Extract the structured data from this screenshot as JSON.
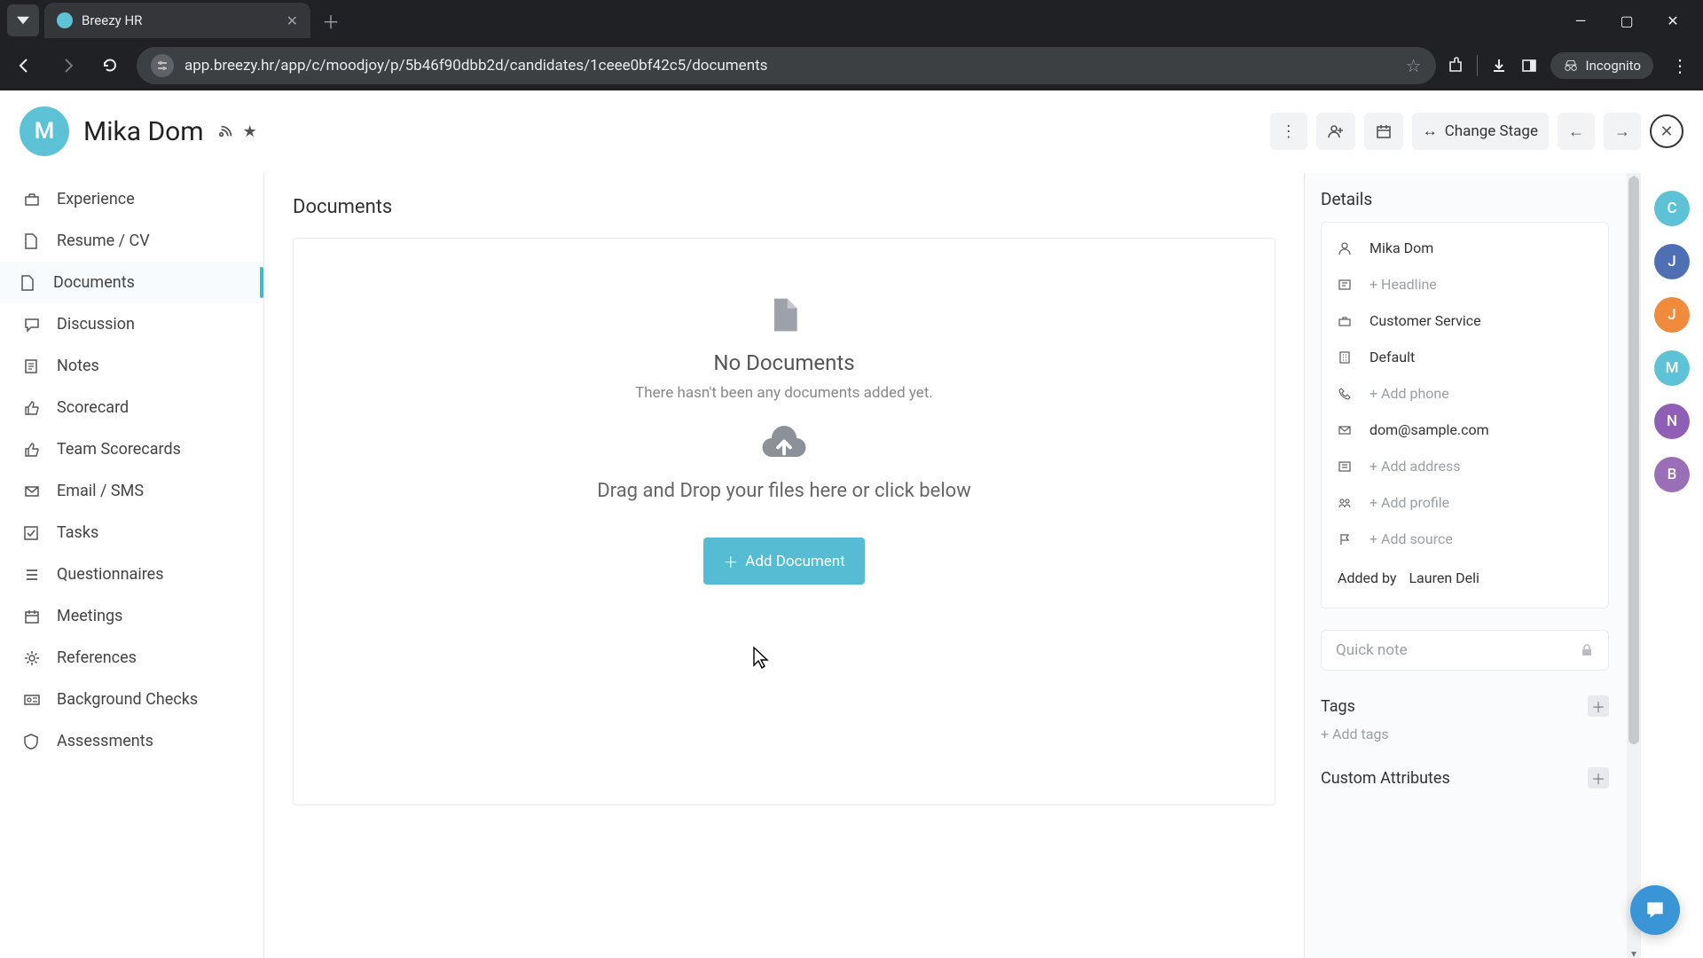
{
  "browser": {
    "tab_title": "Breezy HR",
    "url": "app.breezy.hr/app/c/moodjoy/p/5b46f90dbb2d/candidates/1ceee0bf42c5/documents",
    "incognito_label": "Incognito"
  },
  "header": {
    "avatar_initial": "M",
    "candidate_name": "Mika Dom",
    "change_stage_label": "Change Stage"
  },
  "sidebar": {
    "items": [
      {
        "label": "Experience",
        "icon": "briefcase"
      },
      {
        "label": "Resume / CV",
        "icon": "file"
      },
      {
        "label": "Documents",
        "icon": "file",
        "active": true
      },
      {
        "label": "Discussion",
        "icon": "chat"
      },
      {
        "label": "Notes",
        "icon": "note"
      },
      {
        "label": "Scorecard",
        "icon": "thumbs-up"
      },
      {
        "label": "Team Scorecards",
        "icon": "thumbs-up"
      },
      {
        "label": "Email / SMS",
        "icon": "mail"
      },
      {
        "label": "Tasks",
        "icon": "check-square"
      },
      {
        "label": "Questionnaires",
        "icon": "list"
      },
      {
        "label": "Meetings",
        "icon": "calendar"
      },
      {
        "label": "References",
        "icon": "gear"
      },
      {
        "label": "Background Checks",
        "icon": "id"
      },
      {
        "label": "Assessments",
        "icon": "shield"
      }
    ]
  },
  "main": {
    "section_title": "Documents",
    "empty_title": "No Documents",
    "empty_sub": "There hasn't been any documents added yet.",
    "drag_text": "Drag and Drop your files here or click below",
    "add_button": "Add Document"
  },
  "details": {
    "title": "Details",
    "rows": [
      {
        "icon": "user",
        "text": "Mika Dom",
        "placeholder": false
      },
      {
        "icon": "headline",
        "text": "+ Headline",
        "placeholder": true
      },
      {
        "icon": "briefcase",
        "text": "Customer Service",
        "placeholder": false
      },
      {
        "icon": "building",
        "text": "Default",
        "placeholder": false
      },
      {
        "icon": "phone",
        "text": "+ Add phone",
        "placeholder": true
      },
      {
        "icon": "mail",
        "text": "dom@sample.com",
        "placeholder": false
      },
      {
        "icon": "address",
        "text": "+ Add address",
        "placeholder": true
      },
      {
        "icon": "profile",
        "text": "+ Add profile",
        "placeholder": true
      },
      {
        "icon": "flag",
        "text": "+ Add source",
        "placeholder": true
      }
    ],
    "added_by_label": "Added by",
    "added_by_value": "Lauren Deli",
    "quick_note_placeholder": "Quick note",
    "tags_title": "Tags",
    "tags_placeholder": "+ Add tags",
    "custom_attrs_title": "Custom Attributes"
  },
  "rail": [
    {
      "initial": "C",
      "color": "#5ec2d6"
    },
    {
      "initial": "J",
      "color": "#4f6fb5"
    },
    {
      "initial": "J",
      "color": "#f08a3c"
    },
    {
      "initial": "M",
      "color": "#5ec2d6"
    },
    {
      "initial": "N",
      "color": "#8e5fb5"
    },
    {
      "initial": "B",
      "color": "#9b6fb8"
    }
  ]
}
